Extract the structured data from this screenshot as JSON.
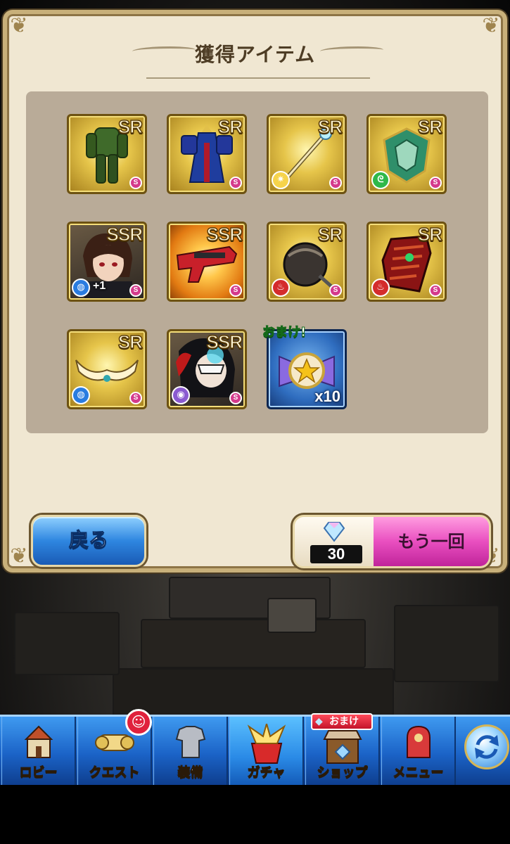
{
  "dialog": {
    "title": "獲得アイテム"
  },
  "items": [
    {
      "rarity": "SR",
      "element": "none",
      "art": "green-armor"
    },
    {
      "rarity": "SR",
      "element": "none",
      "art": "blue-robe"
    },
    {
      "rarity": "SR",
      "element": "light",
      "art": "staff"
    },
    {
      "rarity": "SR",
      "element": "wind",
      "art": "green-shield"
    },
    {
      "rarity": "SSR",
      "element": "water",
      "art": "character-portrait",
      "bonus_text": "+1"
    },
    {
      "rarity": "SSR",
      "element": "none",
      "art": "red-gun"
    },
    {
      "rarity": "SR",
      "element": "fire",
      "art": "black-gauntlet"
    },
    {
      "rarity": "SR",
      "element": "fire",
      "art": "red-scale-armor"
    },
    {
      "rarity": "SR",
      "element": "water",
      "art": "tiara"
    },
    {
      "rarity": "SSR",
      "element": "dark",
      "art": "masked-character"
    }
  ],
  "bonus_item": {
    "tag": "おまけ!",
    "quantity": "x10",
    "art": "star-medal"
  },
  "buttons": {
    "back_label": "戻る",
    "again_label": "もう一回",
    "again_cost": "30"
  },
  "nav": {
    "items": [
      {
        "label": "ロビー",
        "icon": "castle-icon"
      },
      {
        "label": "クエスト",
        "icon": "quest-icon"
      },
      {
        "label": "装備",
        "icon": "armor-icon"
      },
      {
        "label": "ガチャ",
        "icon": "gacha-icon"
      },
      {
        "label": "ショップ",
        "icon": "shop-icon"
      },
      {
        "label": "メニュー",
        "icon": "menu-icon"
      }
    ],
    "shop_ribbon": "おまけ",
    "active_index": 3
  },
  "colors": {
    "dialog_bg": "#f0e7d2",
    "grid_bg": "#b9ab98",
    "nav_blue": "#1b63c7",
    "again_pink": "#e94fc0",
    "back_blue": "#2e86e0"
  }
}
